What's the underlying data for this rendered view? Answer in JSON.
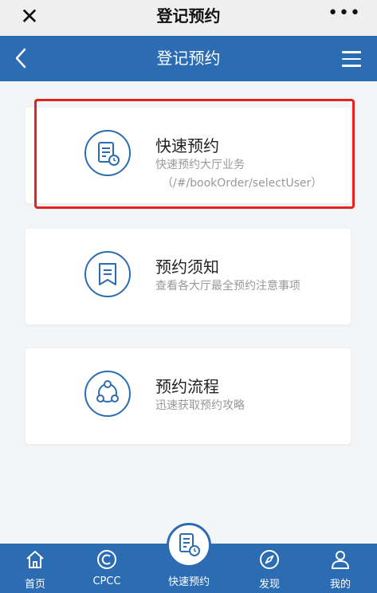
{
  "wechat_bar": {
    "title": "登记预约",
    "close_glyph": "✕",
    "more_glyph": "•••"
  },
  "app_bar": {
    "title": "登记预约",
    "back_icon": "chevron-left-icon",
    "menu_icon": "hamburger-menu-icon"
  },
  "cards": [
    {
      "title": "快速预约",
      "subtitle": "快速预约大厅业务",
      "path": "（/#/bookOrder/selectUser）",
      "icon": "document-clock-icon",
      "highlighted": true
    },
    {
      "title": "预约须知",
      "subtitle": "查看各大厅最全预约注意事项",
      "icon": "bookmark-icon"
    },
    {
      "title": "预约流程",
      "subtitle": "迅速获取预约攻略",
      "icon": "process-cycle-icon"
    }
  ],
  "tabbar": {
    "items": [
      {
        "label": "首页",
        "icon": "home-icon"
      },
      {
        "label": "CPCC",
        "icon": "copyright-circle-icon"
      },
      {
        "label": "快速预约",
        "icon": "document-clock-icon"
      },
      {
        "label": "发现",
        "icon": "compass-icon"
      },
      {
        "label": "我的",
        "icon": "user-icon"
      }
    ]
  },
  "colors": {
    "primary": "#2b6cb3",
    "highlight": "#e4231f",
    "background": "#f4f5f7"
  }
}
